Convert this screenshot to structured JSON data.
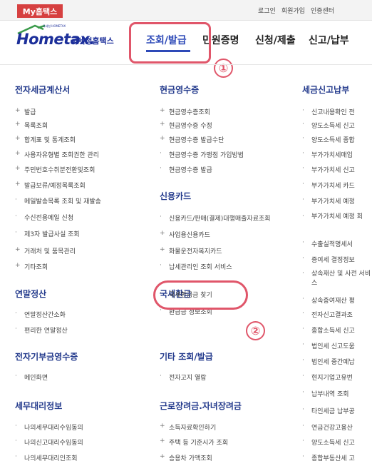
{
  "top": {
    "my_label": "My홈택스",
    "utility": [
      "로그인",
      "회원가입",
      "인증센터"
    ]
  },
  "logo": {
    "brand": "Hometax.",
    "subtitle": "국세청홈택스",
    "tiny": "국세청 HOMETAX"
  },
  "nav": {
    "items": [
      "조회/발급",
      "민원증명",
      "신청/제출",
      "신고/납부"
    ]
  },
  "annotations": {
    "step1": "①",
    "step2": "②"
  },
  "columns": [
    {
      "sections": [
        {
          "heading": "전자세금계산서",
          "items": [
            "발급",
            "목록조회",
            "합계표 및 통계조회",
            "사용자유형별 조회권한 관리",
            "주민번호수취분전환및조회",
            "발급보류/예정목록조회",
            "메일발송목록 조회 및 재발송",
            "수신전용메일 신청",
            "제3자 발급사실 조회",
            "거래처 및 품목관리",
            "기타조회"
          ]
        },
        {
          "heading": "연말정산",
          "items": [
            "연말정산간소화",
            "편리한 연말정산"
          ]
        },
        {
          "heading": "전자기부금영수증",
          "items": [
            "메인화면"
          ]
        },
        {
          "heading": "세무대리정보",
          "items": [
            "나의세무대리수임동의",
            "나의신고대리수임동의",
            "나의세무대리인조회"
          ]
        }
      ]
    },
    {
      "sections": [
        {
          "heading": "현금영수증",
          "items": [
            "현금영수증조회",
            "현금영수증 수정",
            "현금영수증 발급수단",
            "현금영수증 가맹점 가입방법",
            "현금영수증 발급"
          ]
        },
        {
          "heading": "신용카드",
          "items": [
            "신용카드/판매(결제)대행매출자료조회",
            "사업용신용카드",
            "화물운전자복지카드",
            "납세관리인 조회 서비스"
          ]
        },
        {
          "heading": "국세환급",
          "items": [
            "국세환급금 찾기",
            "환급금 정보조회"
          ]
        },
        {
          "heading": "기타 조회/발급",
          "items": [
            "전자고지 열람"
          ]
        },
        {
          "heading": "근로장려금.자녀장려금",
          "items": [
            "소득자료확인하기",
            "주택 등 기준시가 조회",
            "승용차 가액조회"
          ]
        }
      ]
    },
    {
      "sections": [
        {
          "heading": "세금신고납부",
          "items": [
            "신고내용확인 전",
            "양도소득세 신고",
            "양도소득세 종합",
            "부가가치세매입",
            "부가가치세 신고",
            "부가가치세 카드",
            "부가가치세 예정",
            "부가가치세 예정 회",
            "수출실적명세서",
            "증여세 결정정보",
            "상속재산 및 사전 서비스",
            "상속증여재산 평",
            "전자신고결과조",
            "종합소득세 신고",
            "법인세 신고도움",
            "법인세 중간예납",
            "현지기업고유번",
            "납부내역 조회",
            "타인세금 납부공",
            "연금건강고용산",
            "양도소득세 신고",
            "종합부동산세 고"
          ]
        }
      ]
    }
  ]
}
